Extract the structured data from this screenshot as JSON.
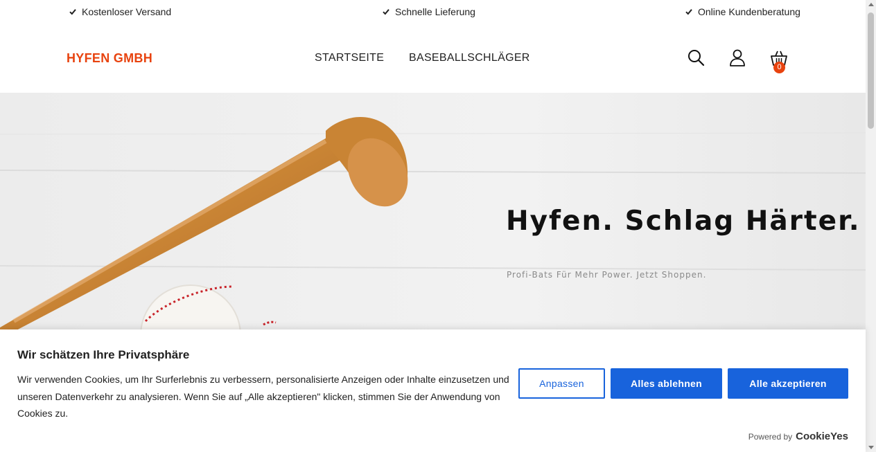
{
  "usp": [
    {
      "label": "Kostenloser Versand"
    },
    {
      "label": "Schnelle Lieferung"
    },
    {
      "label": "Online Kundenberatung"
    }
  ],
  "header": {
    "logo": "HYFEN GMBH",
    "nav": [
      {
        "label": "STARTSEITE"
      },
      {
        "label": "BASEBALLSCHLÄGER"
      }
    ],
    "icons": [
      "search-icon",
      "user-icon",
      "cart-icon"
    ],
    "cart_count": "0"
  },
  "hero": {
    "title": "Hyfen. Schlag Härter.",
    "subtitle": "Profi-Bats Für Mehr Power. Jetzt Shoppen."
  },
  "cookie": {
    "title": "Wir schätzen Ihre Privatsphäre",
    "text": "Wir verwenden Cookies, um Ihr Surferlebnis zu verbessern, personalisierte Anzeigen oder Inhalte einzusetzen und unseren Datenverkehr zu analysieren. Wenn Sie auf „Alle akzeptieren\" klicken, stimmen Sie der Anwendung von Cookies zu.",
    "customize_label": "Anpassen",
    "reject_label": "Alles ablehnen",
    "accept_label": "Alle akzeptieren",
    "powered_by": "Powered by",
    "brand": "CookieYes"
  },
  "colors": {
    "accent": "#e8430f",
    "button_blue": "#1863dc"
  }
}
